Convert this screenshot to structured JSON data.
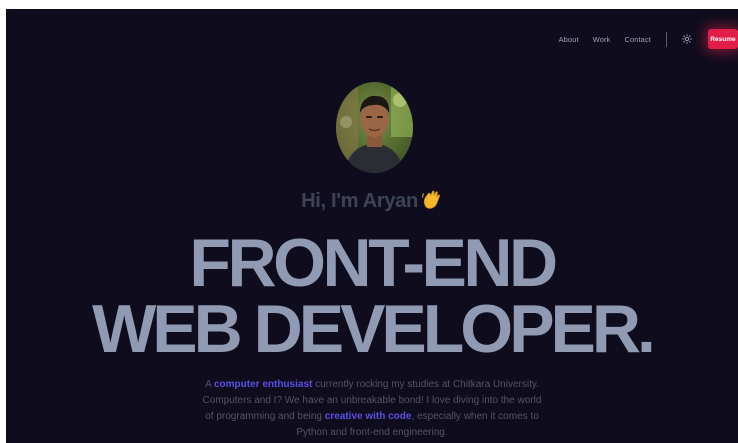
{
  "nav": {
    "links": [
      "About",
      "Work",
      "Contact"
    ],
    "resume_label": "Resume"
  },
  "icons": {
    "theme_toggle": "sun-icon",
    "greeting_emoji": "waving-hand-icon"
  },
  "hero": {
    "greeting": "Hi, I'm Aryan",
    "headline_line1": "FRONT-END",
    "headline_line2": "WEB DEVELOPER.",
    "bio": {
      "p1": "A ",
      "hl1": "computer enthusiast",
      "p2": " currently rocking my studies at Chitkara University. Computers and I? We have an unbreakable bond! I love diving into the world of programming and being ",
      "hl2": "creative with code",
      "p3": ", especially when it comes to Python and front-end engineering."
    }
  },
  "colors": {
    "background": "#0f0d1d",
    "accent": "#e01e48",
    "headline": "#909bb3",
    "highlight": "#5b4fe3"
  }
}
